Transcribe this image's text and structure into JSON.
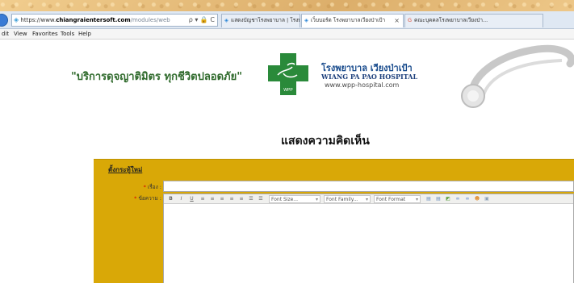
{
  "browser": {
    "url": {
      "proto": "https://www.",
      "host": "chiangraientersoft.com",
      "path": "/modules/web",
      "tools": "ρ ▾ 🔒 C"
    },
    "tabs": [
      {
        "label": "แสดงบัญชาโรงพยาบาล | โรงพยา...",
        "active": false
      },
      {
        "label": "เว็บบอร์ด โรงพยาบาลเวียงป่าเป้า",
        "active": true
      },
      {
        "label": "คณะบุคคลโรงพยาบาลเวียงป่า...",
        "active": false
      }
    ],
    "menu": [
      "dit",
      "View",
      "Favorites",
      "Tools",
      "Help"
    ]
  },
  "header": {
    "slogan": "\"บริการดุจญาติมิตร ทุกชีวิตปลอดภัย\"",
    "hospital_name_th": "โรงพยาบาล เวียงป่าเป้า",
    "hospital_name_en": "WIANG PA PAO HOSPITAL",
    "hospital_url": "www.wpp-hospital.com",
    "logo_text": "WPP"
  },
  "page_title": "แสดงความคิดเห็น",
  "form": {
    "heading": "ตั้งกระทู้ใหม่",
    "subject_label": "เรื่อง :",
    "message_label": "ข้อความ :",
    "required_mark": "*",
    "subject_value": "",
    "toolbar": {
      "bold": "B",
      "italic": "I",
      "underline": "U",
      "font_size": "Font Size...",
      "font_family": "Font Family...",
      "font_format": "Font Format"
    }
  },
  "colors": {
    "panel": "#d9a807",
    "slogan": "#2f6a2c",
    "cross": "#2a8a3a",
    "required": "#d40000"
  }
}
